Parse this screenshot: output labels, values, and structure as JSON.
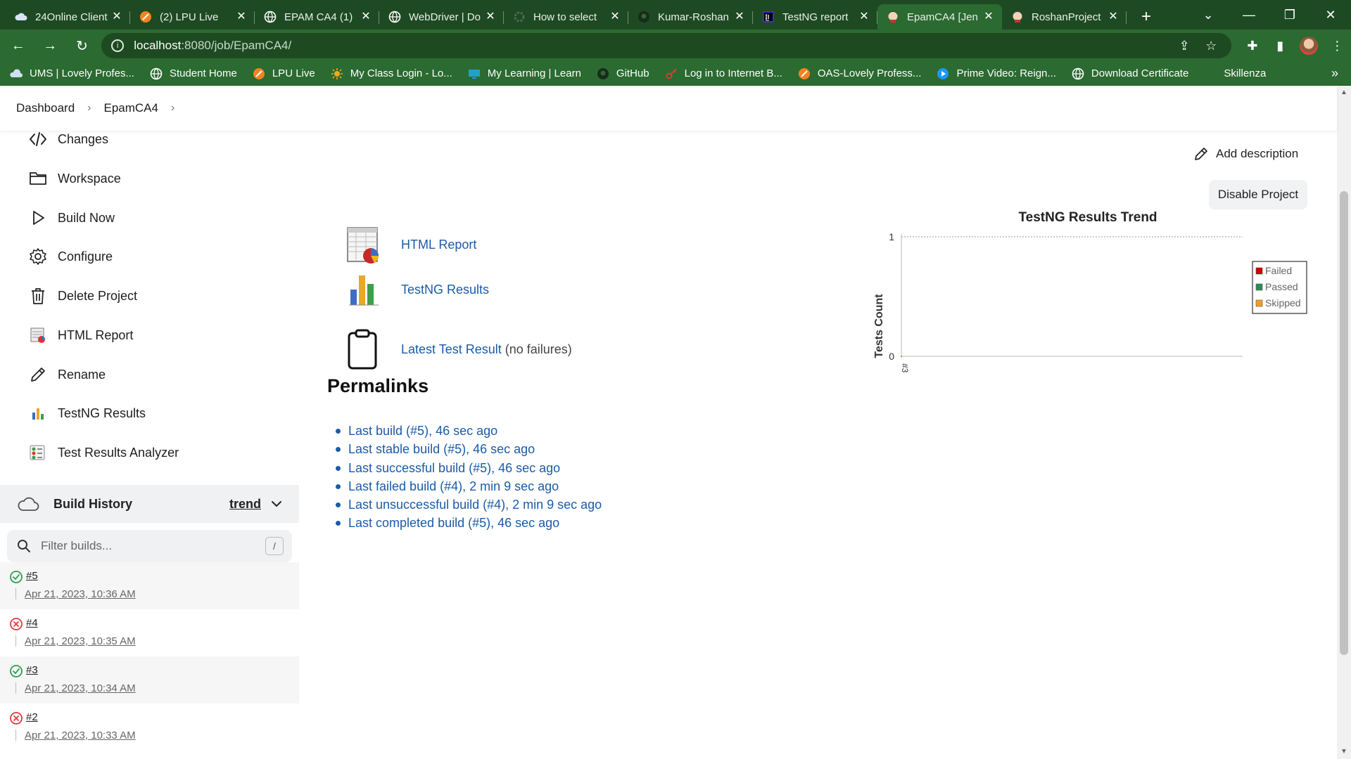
{
  "browser": {
    "tabs": [
      {
        "title": "24Online Client",
        "favicon": "cloud-icon"
      },
      {
        "title": "(2) LPU Live",
        "favicon": "lpu-icon"
      },
      {
        "title": "EPAM CA4 (1)",
        "favicon": "globe-icon"
      },
      {
        "title": "WebDriver | Do",
        "favicon": "globe-icon"
      },
      {
        "title": "How to select",
        "favicon": "gear-icon"
      },
      {
        "title": "Kumar-Roshan",
        "favicon": "github-icon"
      },
      {
        "title": "TestNG report",
        "favicon": "intellij-icon"
      },
      {
        "title": "EpamCA4 [Jen",
        "favicon": "jenkins-icon",
        "active": true
      },
      {
        "title": "RoshanProject",
        "favicon": "jenkins-icon"
      }
    ],
    "url_host": "localhost",
    "url_path": ":8080/job/EpamCA4/",
    "bookmarks": [
      {
        "label": "UMS | Lovely Profes...",
        "icon": "ums-icon"
      },
      {
        "label": "Student Home",
        "icon": "globe-icon"
      },
      {
        "label": "LPU Live",
        "icon": "lpu-icon"
      },
      {
        "label": "My Class Login - Lo...",
        "icon": "sun-icon"
      },
      {
        "label": "My Learning | Learn",
        "icon": "monitor-icon"
      },
      {
        "label": "GitHub",
        "icon": "github-icon"
      },
      {
        "label": "Log in to Internet B...",
        "icon": "key-icon"
      },
      {
        "label": "OAS-Lovely Profess...",
        "icon": "lpu-icon"
      },
      {
        "label": "Prime Video: Reign...",
        "icon": "play-icon"
      },
      {
        "label": "Download Certificate",
        "icon": "globe-icon"
      },
      {
        "label": "Skillenza",
        "icon": "skillenza-icon"
      }
    ]
  },
  "breadcrumb": {
    "items": [
      "Dashboard",
      "EpamCA4"
    ]
  },
  "sidebar": {
    "items": [
      {
        "label": "Changes",
        "icon": "code-icon"
      },
      {
        "label": "Workspace",
        "icon": "folder-icon"
      },
      {
        "label": "Build Now",
        "icon": "play-icon"
      },
      {
        "label": "Configure",
        "icon": "gear-icon"
      },
      {
        "label": "Delete Project",
        "icon": "trash-icon"
      },
      {
        "label": "HTML Report",
        "icon": "html-report-icon"
      },
      {
        "label": "Rename",
        "icon": "pencil-icon"
      },
      {
        "label": "TestNG Results",
        "icon": "bar-chart-icon"
      },
      {
        "label": "Test Results Analyzer",
        "icon": "analyzer-icon"
      }
    ]
  },
  "build_history": {
    "title": "Build History",
    "trend_label": "trend",
    "filter_placeholder": "Filter builds...",
    "filter_shortcut": "/",
    "builds": [
      {
        "number": "#5",
        "date": "Apr 21, 2023, 10:36 AM",
        "status": "success"
      },
      {
        "number": "#4",
        "date": "Apr 21, 2023, 10:35 AM",
        "status": "failed"
      },
      {
        "number": "#3",
        "date": "Apr 21, 2023, 10:34 AM",
        "status": "success"
      },
      {
        "number": "#2",
        "date": "Apr 21, 2023, 10:33 AM",
        "status": "failed"
      }
    ]
  },
  "main": {
    "add_description": "Add description",
    "disable_project": "Disable Project",
    "links": {
      "html_report": "HTML Report",
      "testng_results": "TestNG Results",
      "latest_test_result": "Latest Test Result",
      "latest_test_note": "(no failures)"
    },
    "permalinks_title": "Permalinks",
    "permalinks": [
      "Last build (#5), 46 sec ago",
      "Last stable build (#5), 46 sec ago",
      "Last successful build (#5), 46 sec ago",
      "Last failed build (#4), 2 min 9 sec ago",
      "Last unsuccessful build (#4), 2 min 9 sec ago",
      "Last completed build (#5), 46 sec ago"
    ]
  },
  "chart_data": {
    "type": "line",
    "title": "TestNG Results Trend",
    "ylabel": "Tests Count",
    "xlabel": "",
    "categories": [
      "#3"
    ],
    "ylim": [
      0,
      1
    ],
    "yticks": [
      0,
      1
    ],
    "series": [
      {
        "name": "Failed",
        "color": "#cc0000",
        "values": [
          0
        ]
      },
      {
        "name": "Passed",
        "color": "#2e8b57",
        "values": [
          0
        ]
      },
      {
        "name": "Skipped",
        "color": "#f0a020",
        "values": [
          0
        ]
      }
    ],
    "grid": true,
    "legend": "right"
  },
  "colors": {
    "chrome_dark": "#1e4a23",
    "chrome": "#2b6a31",
    "link": "#1a5ba8",
    "success": "#2e9e4f",
    "failure": "#d93f3f"
  }
}
